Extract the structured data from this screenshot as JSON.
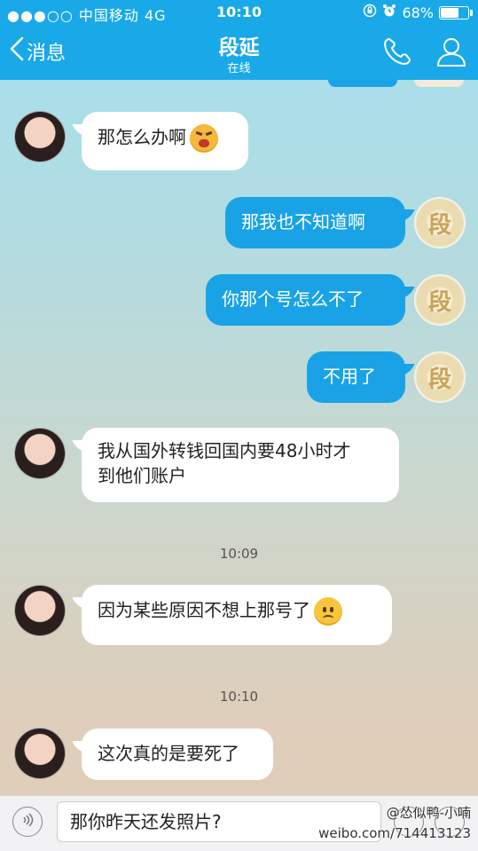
{
  "status_bar": {
    "carrier": "●●●○○ 中国移动   4G",
    "time": "10:10",
    "battery_percent": "68%",
    "battery_level": 0.68
  },
  "nav": {
    "back_label": "消息",
    "contact_name": "段延",
    "contact_status": "在线"
  },
  "messages": [
    {
      "side": "left",
      "text": "那怎么办啊",
      "emoji": "crying-emoji"
    },
    {
      "side": "right",
      "text": "那我也不知道啊"
    },
    {
      "side": "right",
      "text": "你那个号怎么不了"
    },
    {
      "side": "right",
      "text": "不用了"
    },
    {
      "side": "left",
      "text_line1": "我从国外转钱回国内要48小时才",
      "text_line2": "到他们账户"
    },
    {
      "side": "left",
      "text": "因为某些原因不想上那号了",
      "emoji": "sad-emoji"
    },
    {
      "side": "left",
      "text": "这次真的是要死了"
    }
  ],
  "timestamps": [
    "10:09",
    "10:10"
  ],
  "input": {
    "value": "那你昨天还发照片?"
  },
  "watermark": {
    "line1": "@怂似鸭-小喃",
    "line2": "weibo.com/714413123"
  },
  "colors": {
    "header": "#1aa9e8",
    "my_bubble": "#19a3e6",
    "their_bubble": "#ffffff"
  },
  "icons": {
    "back": "chevron-left-icon",
    "phone": "phone-icon",
    "profile": "person-icon",
    "voice": "voice-icon",
    "emoji": "smiley-icon",
    "plus": "plus-icon"
  }
}
